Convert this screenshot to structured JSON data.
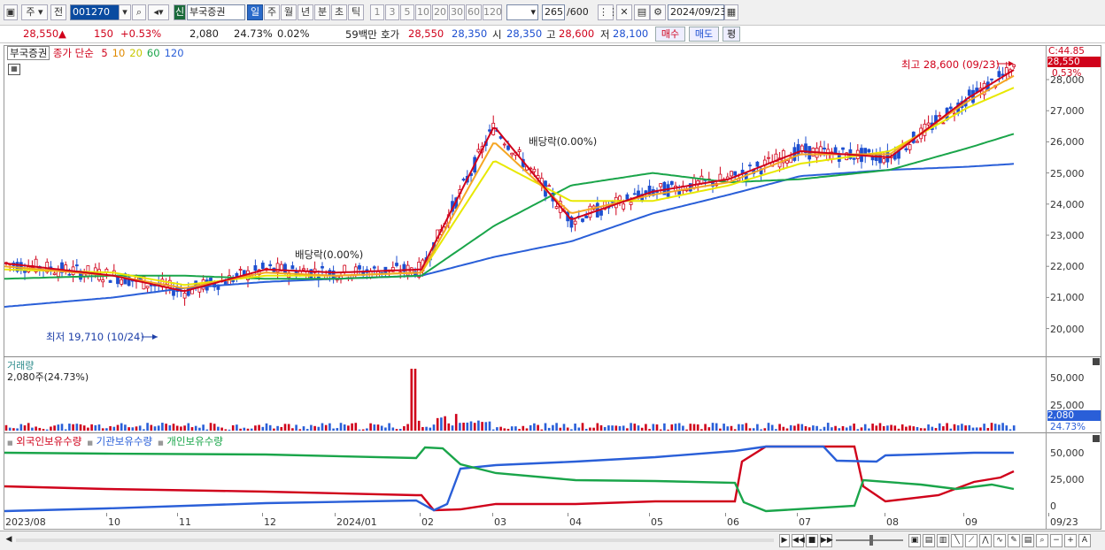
{
  "toolbar": {
    "period_type": "주",
    "prev_label": "전",
    "code": "001270",
    "market_badge": "신",
    "stock_name": "부국증권",
    "periods": [
      "일",
      "주",
      "월",
      "년",
      "분",
      "초",
      "틱"
    ],
    "active_period": "일",
    "minutes": [
      "1",
      "3",
      "5",
      "10",
      "20",
      "30",
      "60",
      "120"
    ],
    "count_value": "265",
    "count_total": "/600",
    "date_value": "2024/09/23"
  },
  "quote": {
    "price": "28,550",
    "change_arrow": "▲",
    "change": "150",
    "change_pct": "+0.53%",
    "volume": "2,080",
    "turnover_pct": "24.73%",
    "ratio": "0.02%",
    "amount": "59백만",
    "hoga_label": "호가",
    "ask": "28,550",
    "bid": "28,350",
    "open_label": "시",
    "open": "28,350",
    "high_label": "고",
    "high": "28,600",
    "low_label": "저",
    "low": "28,100",
    "buy_label": "매수",
    "sell_label": "매도",
    "flat_label": "평"
  },
  "price_panel": {
    "title": "부국증권",
    "legend_prefix": "종가 단순",
    "ma": [
      "5",
      "10",
      "20",
      "60",
      "120"
    ],
    "ma_colors": [
      "#d0021b",
      "#f5a623",
      "#e8e800",
      "#1aa54a",
      "#2a5fd8"
    ],
    "last_close_label": "C:44.85",
    "last_price_badge": "28,550",
    "last_pct": "0.53%",
    "y_ticks": [
      "28,000",
      "27,000",
      "26,000",
      "25,000",
      "24,000",
      "23,000",
      "22,000",
      "21,000",
      "20,000"
    ],
    "max_note": "최고 28,600 (09/23)",
    "min_note": "최저 19,710 (10/24)",
    "dividend_1": "배당락(0.00%)",
    "dividend_2": "배당락(0.00%)"
  },
  "volume_panel": {
    "title": "거래량",
    "value_label": "2,080주(24.73%)",
    "y_ticks": [
      "50,000",
      "25,000"
    ],
    "last_badge": "2,080",
    "last_pct": "24.73%"
  },
  "holdings_panel": {
    "series": [
      "외국인보유수량",
      "기관보유수량",
      "개인보유수량"
    ],
    "series_colors": [
      "#d0021b",
      "#2a5fd8",
      "#1aa54a"
    ],
    "y_ticks": [
      "50,000",
      "25,000",
      "0"
    ]
  },
  "x_axis": [
    "2023/08",
    "10",
    "11",
    "12",
    "2024/01",
    "02",
    "03",
    "04",
    "05",
    "06",
    "07",
    "08",
    "09",
    "09/23"
  ],
  "chart_data": {
    "type": "line",
    "title": "부국증권",
    "x": [
      "2023/08",
      "2023/10",
      "2023/11",
      "2023/12",
      "2024/01",
      "2024/02",
      "2024/03",
      "2024/04",
      "2024/05",
      "2024/06",
      "2024/07",
      "2024/08",
      "2024/09",
      "2024/09/23"
    ],
    "ylim": [
      19500,
      28800
    ],
    "series": [
      {
        "name": "5",
        "values": [
          22100,
          21700,
          21200,
          21900,
          21800,
          21900,
          26500,
          23500,
          24400,
          24800,
          25700,
          25500,
          27400,
          28400
        ]
      },
      {
        "name": "10",
        "values": [
          22000,
          21700,
          21300,
          21800,
          21700,
          21800,
          26000,
          23700,
          24300,
          24700,
          25600,
          25600,
          27300,
          28200
        ]
      },
      {
        "name": "20",
        "values": [
          21900,
          21800,
          21400,
          21700,
          21700,
          21800,
          25400,
          24100,
          24100,
          24600,
          25300,
          25700,
          27100,
          27800
        ]
      },
      {
        "name": "60",
        "values": [
          21600,
          21700,
          21700,
          21600,
          21600,
          21700,
          23300,
          24600,
          25000,
          24700,
          24800,
          25100,
          25800,
          26300
        ]
      },
      {
        "name": "120",
        "values": [
          20700,
          21000,
          21300,
          21500,
          21600,
          21700,
          22300,
          22800,
          23700,
          24300,
          24900,
          25100,
          25200,
          25300
        ]
      }
    ],
    "max": {
      "value": 28600,
      "date": "09/23"
    },
    "min": {
      "value": 19710,
      "date": "10/24"
    }
  }
}
